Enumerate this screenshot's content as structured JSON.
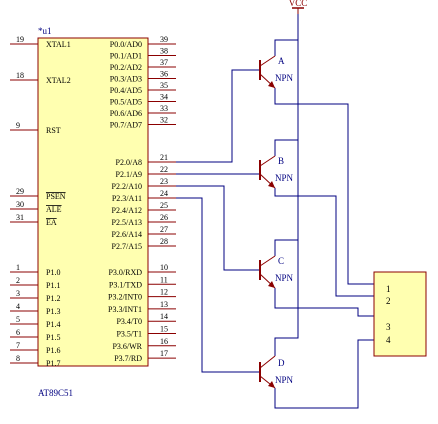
{
  "chip": {
    "designator": "*u1",
    "part_name": "AT89C51",
    "left_pins": [
      {
        "num": "19",
        "name": "XTAL1"
      },
      {
        "num": "18",
        "name": "XTAL2"
      },
      {
        "num": "9",
        "name": "RST"
      },
      {
        "num": "29",
        "name": "PSEN",
        "overbar": true
      },
      {
        "num": "30",
        "name": "ALE",
        "overbar": true
      },
      {
        "num": "31",
        "name": "EA",
        "overbar": true
      },
      {
        "num": "1",
        "name": "P1.0"
      },
      {
        "num": "2",
        "name": "P1.1"
      },
      {
        "num": "3",
        "name": "P1.2"
      },
      {
        "num": "4",
        "name": "P1.3"
      },
      {
        "num": "5",
        "name": "P1.4"
      },
      {
        "num": "6",
        "name": "P1.5"
      },
      {
        "num": "7",
        "name": "P1.6"
      },
      {
        "num": "8",
        "name": "P1.7"
      }
    ],
    "right_pins": [
      {
        "num": "39",
        "name": "P0.0/AD0"
      },
      {
        "num": "38",
        "name": "P0.1/AD1"
      },
      {
        "num": "37",
        "name": "P0.2/AD2"
      },
      {
        "num": "36",
        "name": "P0.3/AD3"
      },
      {
        "num": "35",
        "name": "P0.4/AD5"
      },
      {
        "num": "34",
        "name": "P0.5/AD5"
      },
      {
        "num": "33",
        "name": "P0.6/AD6"
      },
      {
        "num": "32",
        "name": "P0.7/AD7"
      },
      {
        "num": "21",
        "name": "P2.0/A8"
      },
      {
        "num": "22",
        "name": "P2.1/A9"
      },
      {
        "num": "23",
        "name": "P2.2/A10"
      },
      {
        "num": "24",
        "name": "P2.3/A11"
      },
      {
        "num": "25",
        "name": "P2.4/A12"
      },
      {
        "num": "26",
        "name": "P2.5/A13"
      },
      {
        "num": "27",
        "name": "P2.6/A14"
      },
      {
        "num": "28",
        "name": "P2.7/A15"
      },
      {
        "num": "10",
        "name": "P3.0/RXD"
      },
      {
        "num": "11",
        "name": "P3.1/TXD"
      },
      {
        "num": "12",
        "name": "P3.2/INT0"
      },
      {
        "num": "13",
        "name": "P3.3/INT1"
      },
      {
        "num": "14",
        "name": "P3.4/T0"
      },
      {
        "num": "15",
        "name": "P3.5/T1"
      },
      {
        "num": "16",
        "name": "P3.6/WR"
      },
      {
        "num": "17",
        "name": "P3.7/RD"
      }
    ]
  },
  "power": {
    "label": "VCC"
  },
  "transistors": [
    {
      "label": "A",
      "type": "NPN"
    },
    {
      "label": "B",
      "type": "NPN"
    },
    {
      "label": "C",
      "type": "NPN"
    },
    {
      "label": "D",
      "type": "NPN"
    }
  ],
  "connector": {
    "pins": [
      "1",
      "2",
      "3",
      "4"
    ]
  },
  "colors": {
    "component": "#8b0000",
    "wire": "#000080",
    "pin_text": "#000000",
    "chip_fill": "#ffffb0",
    "label_text": "#000080",
    "power": "#8b0000"
  }
}
